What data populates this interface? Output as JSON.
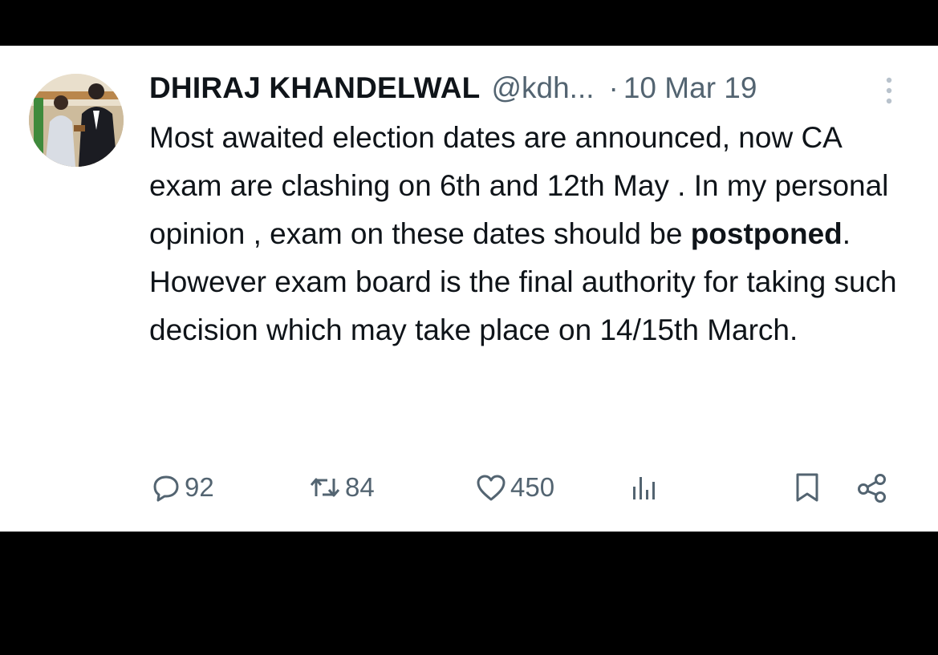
{
  "tweet": {
    "author_name": "DHIRAJ KHANDELWAL",
    "handle": "@kdh...",
    "separator": "·",
    "date": "10 Mar 19",
    "body": {
      "line1": "Most awaited election dates are announced, now CA exam are clashing on 6th and 12th May . In my personal opinion , exam on these dates should be ",
      "bold_word": "postponed",
      "line1_end": ".",
      "line2": "However exam board is the final authority for taking such decision which may take place on 14/15th March."
    },
    "stats": {
      "replies": "92",
      "retweets": "84",
      "likes": "450"
    }
  },
  "icons": {
    "reply": "reply-icon",
    "retweet": "retweet-icon",
    "like": "heart-icon",
    "views": "views-icon",
    "bookmark": "bookmark-icon",
    "share": "share-icon",
    "more": "more-icon"
  },
  "colors": {
    "text": "#0f1419",
    "muted": "#536471",
    "background": "#ffffff",
    "frame": "#000000"
  }
}
